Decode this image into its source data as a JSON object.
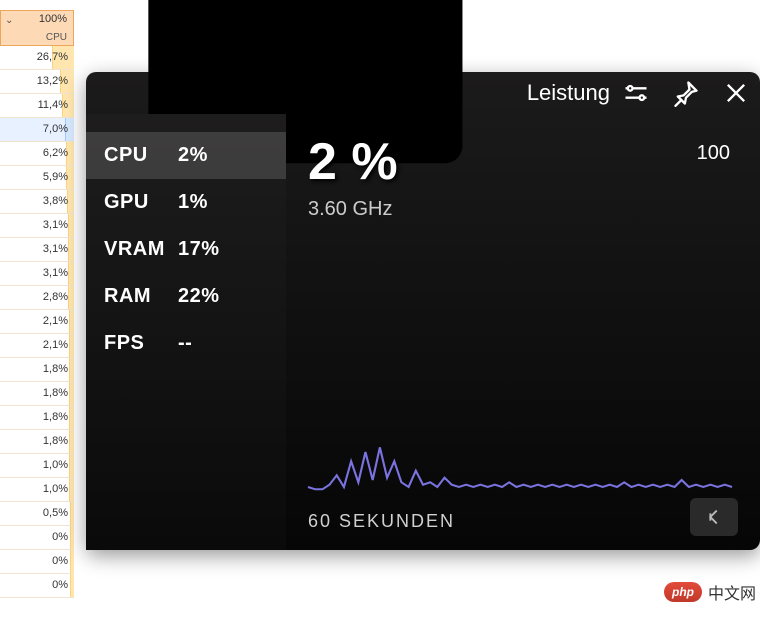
{
  "taskmgr": {
    "header": {
      "value": "100%",
      "label": "CPU"
    },
    "rows": [
      {
        "pct": "26,7%",
        "w": 27
      },
      {
        "pct": "13,2%",
        "w": 15
      },
      {
        "pct": "11,4%",
        "w": 13
      },
      {
        "pct": "7,0%",
        "w": 9,
        "selected": true
      },
      {
        "pct": "6,2%",
        "w": 8
      },
      {
        "pct": "5,9%",
        "w": 8
      },
      {
        "pct": "3,8%",
        "w": 6
      },
      {
        "pct": "3,1%",
        "w": 5
      },
      {
        "pct": "3,1%",
        "w": 5
      },
      {
        "pct": "3,1%",
        "w": 5
      },
      {
        "pct": "2,8%",
        "w": 5
      },
      {
        "pct": "2,1%",
        "w": 4
      },
      {
        "pct": "2,1%",
        "w": 4
      },
      {
        "pct": "1,8%",
        "w": 4
      },
      {
        "pct": "1,8%",
        "w": 4
      },
      {
        "pct": "1,8%",
        "w": 4
      },
      {
        "pct": "1,8%",
        "w": 4
      },
      {
        "pct": "1,0%",
        "w": 3
      },
      {
        "pct": "1,0%",
        "w": 3
      },
      {
        "pct": "0,5%",
        "w": 2
      },
      {
        "pct": "0%",
        "w": 2
      },
      {
        "pct": "0%",
        "w": 2
      },
      {
        "pct": "0%",
        "w": 2
      }
    ]
  },
  "overlay": {
    "title": "Leistung",
    "metrics": [
      {
        "label": "CPU",
        "value": "2%",
        "selected": true
      },
      {
        "label": "GPU",
        "value": "1%"
      },
      {
        "label": "VRAM",
        "value": "17%"
      },
      {
        "label": "RAM",
        "value": "22%"
      },
      {
        "label": "FPS",
        "value": "--"
      }
    ],
    "big_value": "2 %",
    "y_max": "100",
    "freq": "3.60 GHz",
    "x_label": "60 SEKUNDEN"
  },
  "chart_data": {
    "type": "line",
    "title": "CPU",
    "xlabel": "60 SEKUNDEN",
    "ylabel": "",
    "ylim": [
      0,
      100
    ],
    "values": [
      3,
      2,
      2,
      4,
      8,
      3,
      14,
      5,
      18,
      6,
      20,
      7,
      14,
      5,
      3,
      10,
      4,
      5,
      3,
      7,
      4,
      3,
      4,
      3,
      4,
      3,
      4,
      3,
      5,
      3,
      4,
      3,
      4,
      3,
      4,
      3,
      4,
      3,
      4,
      3,
      4,
      3,
      4,
      3,
      5,
      3,
      4,
      3,
      4,
      3,
      4,
      3,
      6,
      3,
      4,
      3,
      4,
      3,
      4,
      3
    ]
  },
  "watermark": {
    "badge": "php",
    "text": "中文网"
  }
}
